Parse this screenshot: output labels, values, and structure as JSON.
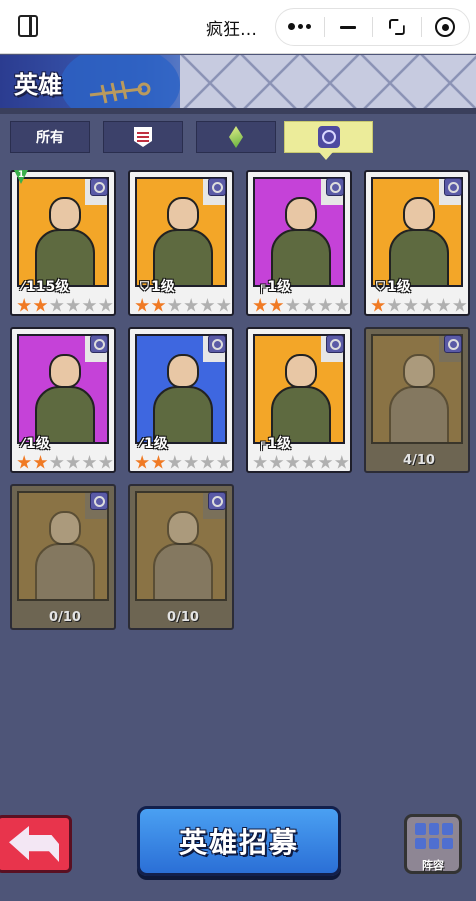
{
  "topbar": {
    "title": "疯狂…",
    "icons": [
      "window-icon",
      "more-dots-icon",
      "minimize-icon",
      "restore-icon",
      "target-icon"
    ]
  },
  "header": {
    "title": "英雄"
  },
  "tabs": [
    {
      "label": "所有",
      "icon": null,
      "active": false
    },
    {
      "label": "",
      "icon": "shield-icon",
      "active": false
    },
    {
      "label": "",
      "icon": "leaf-icon",
      "active": false
    },
    {
      "label": "",
      "icon": "eye-icon",
      "active": true
    }
  ],
  "heroes": [
    {
      "level": "115级",
      "weapon": "rifle",
      "stars": 2,
      "badge": "1",
      "locked": false,
      "bg": "#f3a628"
    },
    {
      "level": "1级",
      "weapon": "shield",
      "stars": 2,
      "badge": "",
      "locked": false,
      "bg": "#f3a628"
    },
    {
      "level": "1级",
      "weapon": "pistol",
      "stars": 2,
      "badge": "",
      "locked": false,
      "bg": "#c542d8"
    },
    {
      "level": "1级",
      "weapon": "shield",
      "stars": 1,
      "badge": "",
      "locked": false,
      "bg": "#f3a628"
    },
    {
      "level": "1级",
      "weapon": "rifle",
      "stars": 2,
      "badge": "",
      "locked": false,
      "bg": "#c542d8"
    },
    {
      "level": "1级",
      "weapon": "rifle",
      "stars": 2,
      "badge": "",
      "locked": false,
      "bg": "#3e67e0"
    },
    {
      "level": "1级",
      "weapon": "pistol",
      "stars": 0,
      "badge": "",
      "locked": false,
      "bg": "#f3a628"
    },
    {
      "progress": "4/10",
      "locked": true,
      "bg": "#8a7345"
    },
    {
      "progress": "0/10",
      "locked": true,
      "bg": "#8a7345"
    },
    {
      "progress": "0/10",
      "locked": true,
      "bg": "#8a7345"
    }
  ],
  "buttons": {
    "recruit_label": "英雄招募",
    "lineup_label": "阵容",
    "back_icon": "back-arrow-icon"
  },
  "colors": {
    "background": "#4e5578",
    "recruit": "#2b6fd6",
    "back": "#e8344c",
    "active_tab": "#ecec9a"
  }
}
